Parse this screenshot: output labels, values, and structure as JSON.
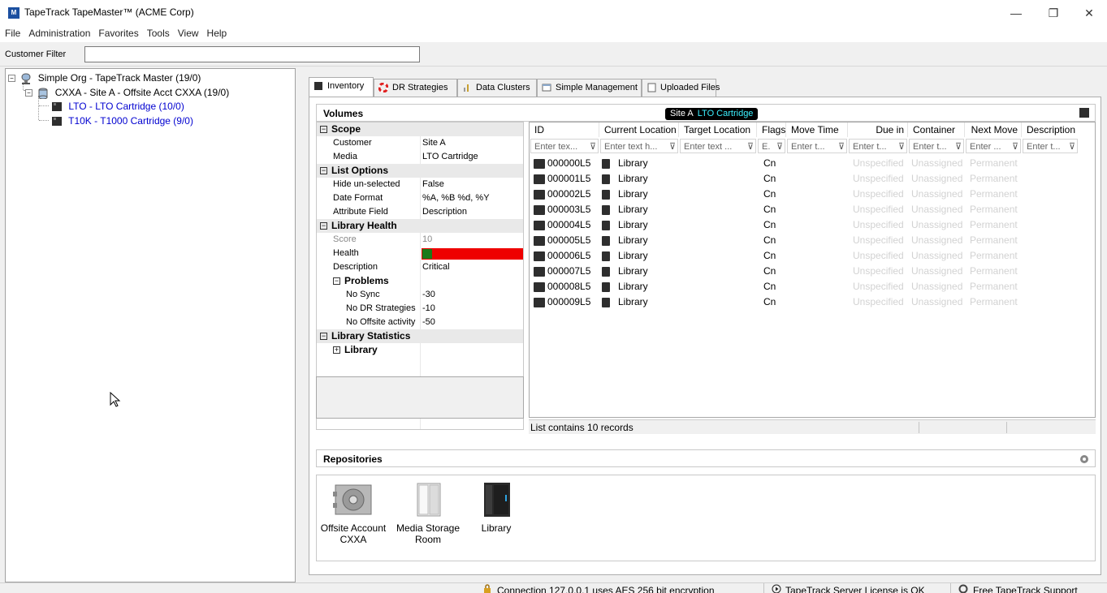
{
  "window": {
    "title": "TapeTrack TapeMaster™ (ACME Corp)",
    "app_icon_text": "M",
    "controls": {
      "minimize": "—",
      "restore": "❐",
      "close": "✕"
    }
  },
  "menu": [
    "File",
    "Administration",
    "Favorites",
    "Tools",
    "View",
    "Help"
  ],
  "customer_filter": {
    "label": "Customer Filter",
    "value": ""
  },
  "tree": [
    {
      "label": "Simple Org - TapeTrack Master (19/0)"
    },
    {
      "label": "CXXA - Site A - Offsite Acct CXXA (19/0)"
    },
    {
      "label": "LTO - LTO Cartridge (10/0)"
    },
    {
      "label": "T10K - T1000 Cartridge (9/0)"
    }
  ],
  "tree_expander": "−",
  "tabs": [
    {
      "label": "Inventory",
      "active": true
    },
    {
      "label": "DR Strategies"
    },
    {
      "label": "Data Clusters"
    },
    {
      "label": "Simple Management"
    },
    {
      "label": "Uploaded Files"
    }
  ],
  "volumes": {
    "title": "Volumes",
    "breadcrumb": {
      "site": "Site A",
      "media": "LTO Cartridge"
    }
  },
  "properties": {
    "scope": {
      "title": "Scope",
      "customer_key": "Customer",
      "customer_val": "Site A",
      "media_key": "Media",
      "media_val": "LTO Cartridge"
    },
    "list_options": {
      "title": "List Options",
      "hide_key": "Hide un-selected",
      "hide_val": "False",
      "date_key": "Date Format",
      "date_val": "%A, %B %d, %Y",
      "attr_key": "Attribute Field",
      "attr_val": "Description"
    },
    "library_health": {
      "title": "Library Health",
      "score_key": "Score",
      "score_val": "10",
      "health_key": "Health",
      "health_level": 0.1,
      "desc_key": "Description",
      "desc_val": "Critical",
      "problems_title": "Problems",
      "nosync_key": "No Sync",
      "nosync_val": "-30",
      "nodr_key": "No DR Strategies",
      "nodr_val": "-10",
      "nooff_key": "No Offsite activity",
      "nooff_val": "-50"
    },
    "library_statistics": {
      "title": "Library Statistics",
      "library": "Library"
    },
    "collapse_glyph": "−",
    "expand_glyph": "+"
  },
  "grid": {
    "columns": [
      "ID",
      "Current Location",
      "Target Location",
      "Flags",
      "Move Time",
      "Due in",
      "Container",
      "Next Move",
      "Description"
    ],
    "filters": [
      "Enter tex...",
      "Enter text h...",
      "Enter text ...",
      "E.",
      "Enter t...",
      "Enter t...",
      "Enter t...",
      "Enter ...",
      "Enter t..."
    ],
    "filter_icon": "⊽",
    "rows": [
      {
        "id": "000000L5",
        "location": "Library",
        "flags": "Cn",
        "due": "Unspecified",
        "container": "Unassigned",
        "next": "Permanent"
      },
      {
        "id": "000001L5",
        "location": "Library",
        "flags": "Cn",
        "due": "Unspecified",
        "container": "Unassigned",
        "next": "Permanent"
      },
      {
        "id": "000002L5",
        "location": "Library",
        "flags": "Cn",
        "due": "Unspecified",
        "container": "Unassigned",
        "next": "Permanent"
      },
      {
        "id": "000003L5",
        "location": "Library",
        "flags": "Cn",
        "due": "Unspecified",
        "container": "Unassigned",
        "next": "Permanent"
      },
      {
        "id": "000004L5",
        "location": "Library",
        "flags": "Cn",
        "due": "Unspecified",
        "container": "Unassigned",
        "next": "Permanent"
      },
      {
        "id": "000005L5",
        "location": "Library",
        "flags": "Cn",
        "due": "Unspecified",
        "container": "Unassigned",
        "next": "Permanent"
      },
      {
        "id": "000006L5",
        "location": "Library",
        "flags": "Cn",
        "due": "Unspecified",
        "container": "Unassigned",
        "next": "Permanent"
      },
      {
        "id": "000007L5",
        "location": "Library",
        "flags": "Cn",
        "due": "Unspecified",
        "container": "Unassigned",
        "next": "Permanent"
      },
      {
        "id": "000008L5",
        "location": "Library",
        "flags": "Cn",
        "due": "Unspecified",
        "container": "Unassigned",
        "next": "Permanent"
      },
      {
        "id": "000009L5",
        "location": "Library",
        "flags": "Cn",
        "due": "Unspecified",
        "container": "Unassigned",
        "next": "Permanent"
      }
    ],
    "status": "List contains 10 records"
  },
  "repositories": {
    "title": "Repositories",
    "items": [
      {
        "line1": "Offsite Account",
        "line2": "CXXA"
      },
      {
        "line1": "Media Storage",
        "line2": "Room"
      },
      {
        "line1": "Library",
        "line2": ""
      }
    ]
  },
  "statusbar": {
    "encryption": "Connection 127.0.0.1 uses AES 256 bit encryption",
    "license": "TapeTrack Server License is OK",
    "support": "Free TapeTrack Support"
  },
  "colors": {
    "health_good": "#1a7a1a",
    "health_bad": "#ee0000",
    "tree_link": "#0000d0",
    "breadcrumb_media": "#3cf0ff"
  }
}
